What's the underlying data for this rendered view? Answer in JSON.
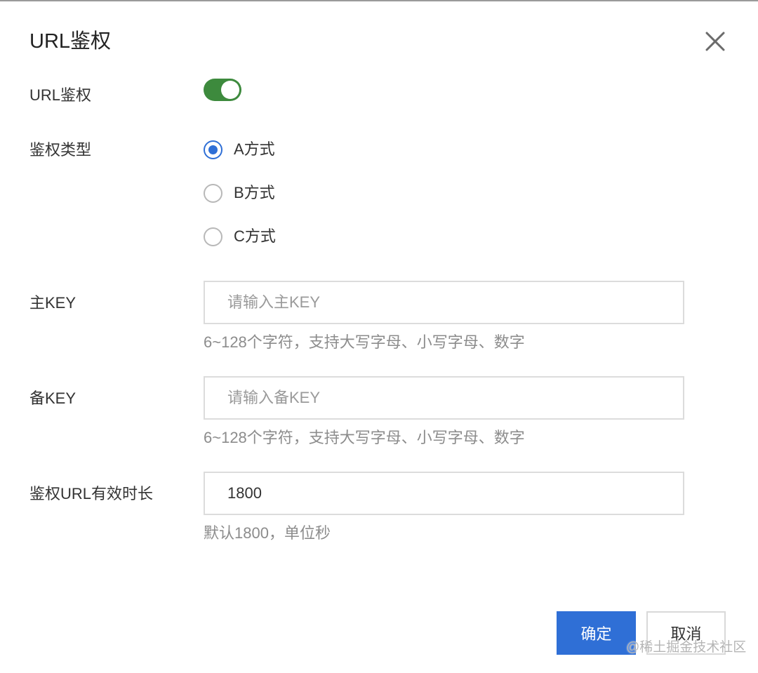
{
  "dialog": {
    "title": "URL鉴权",
    "close_icon": "close-icon"
  },
  "form": {
    "url_auth": {
      "label": "URL鉴权",
      "enabled": true,
      "switch_color": "#3d8a3d"
    },
    "auth_type": {
      "label": "鉴权类型",
      "options": [
        {
          "label": "A方式",
          "checked": true
        },
        {
          "label": "B方式",
          "checked": false
        },
        {
          "label": "C方式",
          "checked": false
        }
      ],
      "accent_color": "#2f6fd6"
    },
    "primary_key": {
      "label": "主KEY",
      "value": "",
      "placeholder": "请输入主KEY",
      "hint": "6~128个字符，支持大写字母、小写字母、数字"
    },
    "backup_key": {
      "label": "备KEY",
      "value": "",
      "placeholder": "请输入备KEY",
      "hint": "6~128个字符，支持大写字母、小写字母、数字"
    },
    "ttl": {
      "label": "鉴权URL有效时长",
      "value": "1800",
      "hint": "默认1800，单位秒"
    }
  },
  "footer": {
    "confirm_label": "确定",
    "cancel_label": "取消",
    "confirm_color": "#2f6fd6"
  },
  "watermark": "@稀土掘金技术社区"
}
